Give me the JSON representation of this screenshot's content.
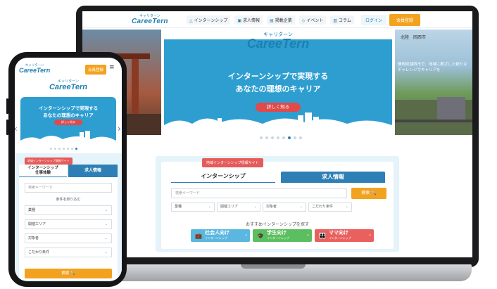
{
  "laptop": {
    "nav": {
      "logo_small": "キャリターン",
      "logo_big": "CareeTern",
      "items": [
        {
          "icon": "△",
          "label": "インターンシップ"
        },
        {
          "icon": "▣",
          "label": "求人情報"
        },
        {
          "icon": "▤",
          "label": "掲載企業"
        },
        {
          "icon": "◇",
          "label": "イベント"
        },
        {
          "icon": "▥",
          "label": "コラム"
        }
      ],
      "login": "ログイン",
      "register": "会員登録"
    },
    "hero": {
      "brand_small": "キャリターン",
      "brand_big": "CareeTern",
      "headline_1": "インターンシップで実現する",
      "headline_2": "あなたの理想のキャリア",
      "cta": "詳しく知る",
      "right_caption": "北陸　岡西市",
      "right_text": "静岡県湖西市で、地域に根ざした新たなチャレンジでキャリアを"
    },
    "search": {
      "badge": "地域インターンシップ情報サイト",
      "tab_active": "インターンシップ",
      "tab_inactive": "求人情報",
      "keyword_placeholder": "検索キーワード",
      "search_button": "検索 🔍",
      "selects": [
        "業種",
        "開催エリア",
        "対象者",
        "こだわり条件"
      ],
      "recommend_label": "おすすめインターンシップを探す",
      "categories": [
        {
          "icon": "💼",
          "title": "社会人向け",
          "sub": "インターンシップ",
          "color": "#5bb7e0"
        },
        {
          "icon": "🎓",
          "title": "学生向け",
          "sub": "インターンシップ",
          "color": "#5cbf5f"
        },
        {
          "icon": "👪",
          "title": "ママ向け",
          "sub": "インターンシップ",
          "color": "#e8615e"
        }
      ]
    }
  },
  "phone": {
    "logo_small": "キャリターン",
    "logo_big": "CareeTern",
    "register": "会員登録",
    "menu_icon": "≡",
    "hero": {
      "brand_small": "キャリターン",
      "brand_big": "CareeTern",
      "headline_1": "インターンシップで実現する",
      "headline_2": "あなたの理想のキャリア",
      "cta": "詳しく知る",
      "arrow_left": "‹",
      "arrow_right": "›"
    },
    "form": {
      "badge": "地域インターンシップ情報サイト",
      "tab_active_1": "インターンシップ",
      "tab_active_2": "仕事体験",
      "tab_inactive": "求人情報",
      "keyword_placeholder": "検索キーワード",
      "narrow_label": "条件を絞り込む",
      "selects": [
        "業種",
        "開催エリア",
        "対象者",
        "こだわり条件"
      ],
      "search_button": "検索 🔍"
    }
  },
  "colors": {
    "brand_blue": "#1d7fb0",
    "hero_blue": "#2e9ed1",
    "accent_orange": "#f3a21f",
    "cta_red": "#e04a4a"
  }
}
